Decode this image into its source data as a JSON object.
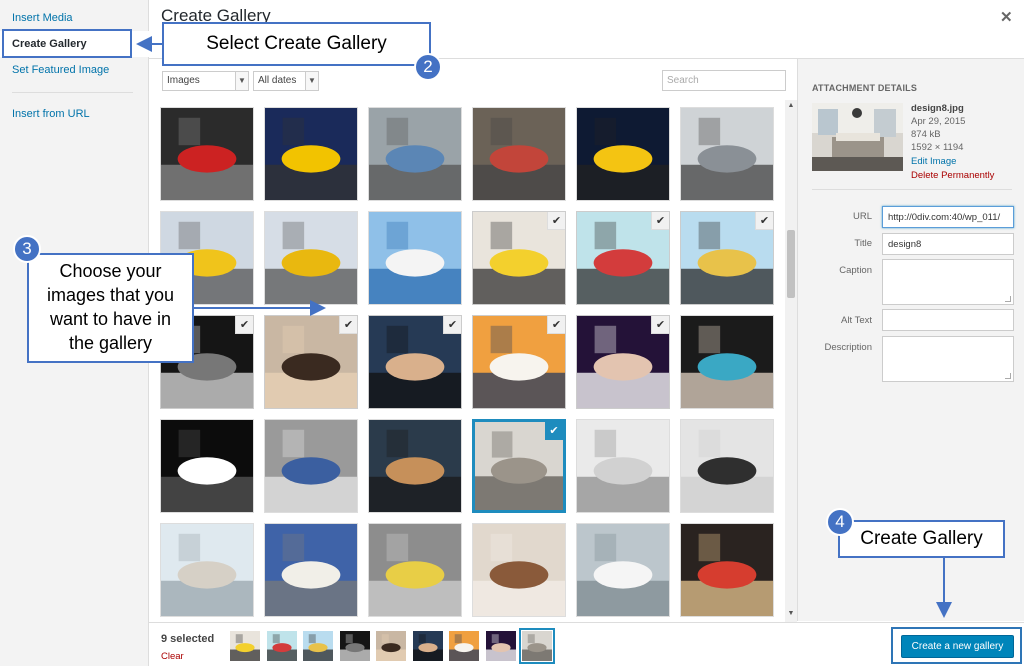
{
  "menu": {
    "items": [
      {
        "label": "Insert Media",
        "active": false
      },
      {
        "label": "Create Gallery",
        "active": true
      },
      {
        "label": "Set Featured Image",
        "active": false
      },
      {
        "label": "Insert from URL",
        "active": false
      }
    ]
  },
  "modal": {
    "title": "Create Gallery",
    "close_icon": "close-icon"
  },
  "toolbar": {
    "type_filter": "Images",
    "date_filter": "All dates",
    "search_placeholder": "Search"
  },
  "grid": {
    "tiles": [
      {
        "subject": "red sports car",
        "selected": false
      },
      {
        "subject": "yellow car",
        "selected": false
      },
      {
        "subject": "blue beetle",
        "selected": false
      },
      {
        "subject": "cars in street",
        "selected": false
      },
      {
        "subject": "yellow car at night",
        "selected": false
      },
      {
        "subject": "silver car",
        "selected": false
      },
      {
        "subject": "yellow car at show",
        "selected": false
      },
      {
        "subject": "yellow car at show",
        "selected": false
      },
      {
        "subject": "santorini windmill",
        "selected": false
      },
      {
        "subject": "woman in yellow",
        "selected": true
      },
      {
        "subject": "woman with phone",
        "selected": true
      },
      {
        "subject": "men dancing",
        "selected": true
      },
      {
        "subject": "dj music",
        "selected": true
      },
      {
        "subject": "woman sunglasses",
        "selected": true
      },
      {
        "subject": "woman face",
        "selected": true
      },
      {
        "subject": "santorini sunset",
        "selected": true
      },
      {
        "subject": "suicide sheep",
        "selected": true
      },
      {
        "subject": "electro dance",
        "selected": false
      },
      {
        "subject": "suicide sheep dark",
        "selected": false
      },
      {
        "subject": "future music",
        "selected": false
      },
      {
        "subject": "singer",
        "selected": false
      },
      {
        "subject": "bedroom",
        "selected": true,
        "focused": true
      },
      {
        "subject": "white living room",
        "selected": false
      },
      {
        "subject": "modern living room",
        "selected": false
      },
      {
        "subject": "panorama living room",
        "selected": false
      },
      {
        "subject": "blue wall sofa",
        "selected": false
      },
      {
        "subject": "grey living room",
        "selected": false
      },
      {
        "subject": "wood floor room",
        "selected": false
      },
      {
        "subject": "white kitchen",
        "selected": false
      },
      {
        "subject": "breakfast bowls",
        "selected": false
      }
    ]
  },
  "details": {
    "heading": "ATTACHMENT DETAILS",
    "filename": "design8.jpg",
    "date": "Apr 29, 2015",
    "size": "874 kB",
    "dimensions": "1592 × 1194",
    "edit_label": "Edit Image",
    "delete_label": "Delete Permanently",
    "fields": {
      "url_label": "URL",
      "url_value": "http://0div.com:40/wp_011/",
      "title_label": "Title",
      "title_value": "design8",
      "caption_label": "Caption",
      "alt_label": "Alt Text",
      "description_label": "Description"
    }
  },
  "selection": {
    "count_label": "9 selected",
    "clear_label": "Clear"
  },
  "actions": {
    "create_label": "Create a new gallery"
  },
  "callouts": {
    "step2_number": "2",
    "step2_text": "Select Create Gallery",
    "step3_number": "3",
    "step3_text": "Choose your images that you want to have in the gallery",
    "step4_number": "4",
    "step4_text": "Create Gallery"
  },
  "colors": {
    "accent": "#0073aa",
    "primary_button": "#0085ba",
    "callout_border": "#4472c4",
    "delete": "#aa0000"
  }
}
